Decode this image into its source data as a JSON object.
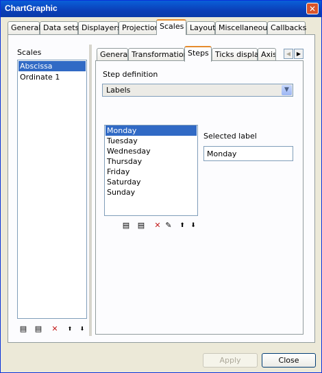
{
  "window": {
    "title": "ChartGraphic",
    "close_glyph": "✕"
  },
  "top_tabs": [
    {
      "label": "General"
    },
    {
      "label": "Data sets"
    },
    {
      "label": "Displayers"
    },
    {
      "label": "Projection"
    },
    {
      "label": "Scales"
    },
    {
      "label": "Layout"
    },
    {
      "label": "Miscellaneous"
    },
    {
      "label": "Callbacks"
    }
  ],
  "scales": {
    "label": "Scales",
    "items": [
      "Abscissa",
      "Ordinate 1"
    ],
    "selected": "Abscissa"
  },
  "inner_tabs": [
    {
      "label": "General"
    },
    {
      "label": "Transformation"
    },
    {
      "label": "Steps"
    },
    {
      "label": "Ticks display"
    },
    {
      "label": "Axis"
    }
  ],
  "steps": {
    "step_definition_label": "Step definition",
    "step_definition_value": "Labels",
    "labels": [
      "Monday",
      "Tuesday",
      "Wednesday",
      "Thursday",
      "Friday",
      "Saturday",
      "Sunday"
    ],
    "selected_label_caption": "Selected label",
    "selected_label_value": "Monday"
  },
  "icons": {
    "scroll_left": "◀",
    "scroll_right": "▶",
    "dropdown": "▼",
    "insert_before": "▤",
    "insert_after": "▤",
    "delete": "✕",
    "edit": "✎",
    "move_up": "⬆",
    "move_down": "⬇"
  },
  "footer": {
    "apply_label": "Apply",
    "close_label": "Close"
  },
  "colors": {
    "selection": "#316ac5",
    "active_tab_accent": "#e68b2c",
    "titlebar": "#0a5fd8"
  }
}
